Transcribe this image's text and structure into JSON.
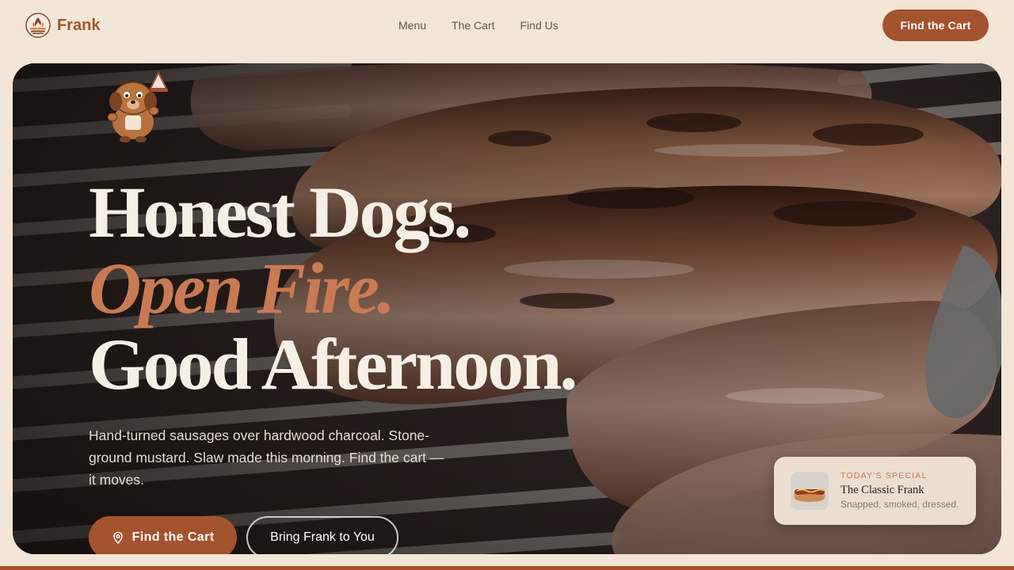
{
  "brand": {
    "name": "Frank",
    "logo_icon": "grill-flame-logo-icon"
  },
  "nav": {
    "links": [
      "Menu",
      "The Cart",
      "Find Us"
    ],
    "cta_label": "Find the Cart"
  },
  "hero": {
    "background": "grilled-sausages-photo",
    "mascot_icon": "dog-mascot-with-cone-icon",
    "headline": {
      "line1": "Honest Dogs.",
      "line2": "Open Fire.",
      "line3": "Good Afternoon."
    },
    "copy": "Hand-turned sausages over hardwood charcoal. Stone-ground mustard. Slaw made this morning. Find the cart — it moves.",
    "primary_button": {
      "label": "Find the Cart",
      "icon": "location-pin-icon"
    },
    "secondary_button": {
      "label": "Bring Frank to You"
    }
  },
  "special": {
    "eyebrow": "TODAY'S SPECIAL",
    "title": "The Classic Frank",
    "description": "Snapped, smoked, dressed.",
    "thumb_icon": "hot-dog-thumbnail-icon"
  },
  "colors": {
    "page_bg": "#f3e6d6",
    "brand": "#a4532f",
    "accent_text": "#c97a52",
    "headline_text": "#f6efe6"
  }
}
